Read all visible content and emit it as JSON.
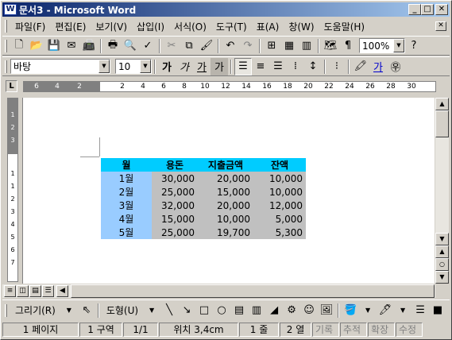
{
  "window": {
    "title": "문서3 - Microsoft Word",
    "app_icon": "W"
  },
  "title_buttons": {
    "minimize": "_",
    "maximize": "□",
    "close": "✕"
  },
  "menu": [
    "파일(F)",
    "편집(E)",
    "보기(V)",
    "삽입(I)",
    "서식(O)",
    "도구(T)",
    "표(A)",
    "창(W)",
    "도움말(H)"
  ],
  "mdi_close": "✕",
  "toolbar_standard": {
    "zoom": "100%",
    "help": "?"
  },
  "toolbar_format": {
    "font": "바탕",
    "size": "10",
    "bold": "가",
    "italic": "가",
    "underline": "가",
    "char_shade": "가",
    "font_color_glyph": "가"
  },
  "ruler_labels": [
    "6",
    "4",
    "2",
    "2",
    "4",
    "6",
    "8",
    "10",
    "12",
    "14",
    "16",
    "18",
    "20",
    "22",
    "24",
    "26",
    "28",
    "30"
  ],
  "vruler_labels": [
    "1",
    "2",
    "3",
    "1",
    "1",
    "2",
    "3",
    "4",
    "5",
    "6",
    "7"
  ],
  "ruler_corner": "L",
  "table": {
    "headers": [
      "월",
      "용돈",
      "지출금액",
      "잔액"
    ],
    "rows": [
      [
        "1월",
        "30,000",
        "20,000",
        "10,000"
      ],
      [
        "2월",
        "25,000",
        "15,000",
        "10,000"
      ],
      [
        "3월",
        "32,000",
        "20,000",
        "12,000"
      ],
      [
        "4월",
        "15,000",
        "10,000",
        "5,000"
      ],
      [
        "5월",
        "25,000",
        "19,700",
        "5,300"
      ]
    ]
  },
  "drawing_toolbar": {
    "draw": "그리기(R)",
    "autoshapes": "도형(U)"
  },
  "status": {
    "page": "1 페이지",
    "section": "1 구역",
    "pages": "1/1",
    "position": "위치 3,4cm",
    "line": "1 줄",
    "column": "2 열",
    "rec": "기록",
    "trk": "추적",
    "ext": "확장",
    "ovr": "수정"
  }
}
